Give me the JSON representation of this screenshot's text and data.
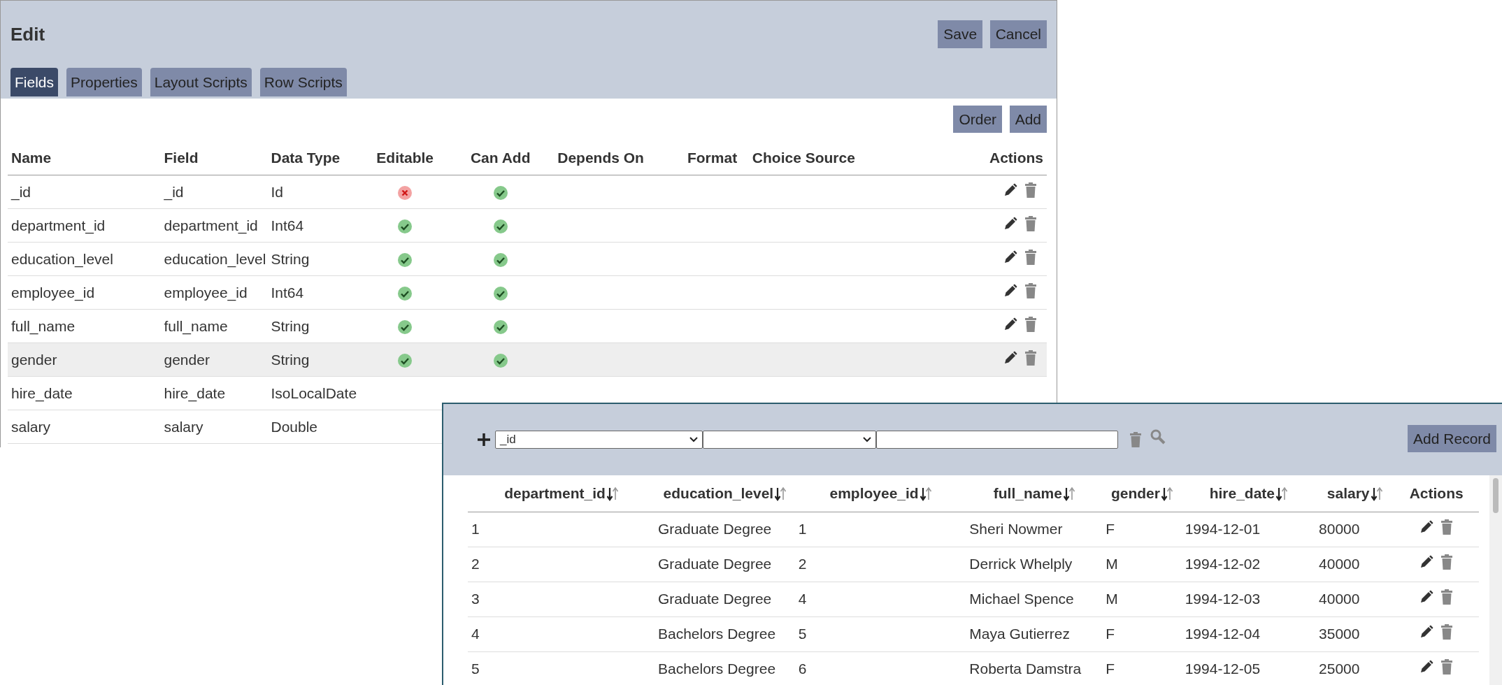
{
  "editor": {
    "title": "Edit",
    "buttons": [
      "Save",
      "Cancel"
    ],
    "tabs": [
      {
        "label": "Fields",
        "selected": true
      },
      {
        "label": "Properties",
        "selected": false
      },
      {
        "label": "Layout Scripts",
        "selected": false
      },
      {
        "label": "Row Scripts",
        "selected": false
      }
    ],
    "toolbar_buttons": [
      "Order",
      "Add"
    ],
    "table": {
      "columns": [
        "Name",
        "Field",
        "Data Type",
        "Editable",
        "Can Add",
        "Depends On",
        "Format",
        "Choice Source",
        "Actions"
      ],
      "rows": [
        {
          "name": "_id",
          "field": "_id",
          "data_type": "Id",
          "editable": false,
          "can_add": true,
          "selected": false
        },
        {
          "name": "department_id",
          "field": "department_id",
          "data_type": "Int64",
          "editable": true,
          "can_add": true,
          "selected": false
        },
        {
          "name": "education_level",
          "field": "education_level",
          "data_type": "String",
          "editable": true,
          "can_add": true,
          "selected": false
        },
        {
          "name": "employee_id",
          "field": "employee_id",
          "data_type": "Int64",
          "editable": true,
          "can_add": true,
          "selected": false
        },
        {
          "name": "full_name",
          "field": "full_name",
          "data_type": "String",
          "editable": true,
          "can_add": true,
          "selected": false
        },
        {
          "name": "gender",
          "field": "gender",
          "data_type": "String",
          "editable": true,
          "can_add": true,
          "selected": true
        },
        {
          "name": "hire_date",
          "field": "hire_date",
          "data_type": "IsoLocalDate",
          "selected": false
        },
        {
          "name": "salary",
          "field": "salary",
          "data_type": "Double",
          "selected": false
        }
      ]
    }
  },
  "records": {
    "filter": {
      "field_select": "_id"
    },
    "add_button": "Add Record",
    "table": {
      "columns": [
        "department_id",
        "education_level",
        "employee_id",
        "full_name",
        "gender",
        "hire_date",
        "salary",
        "Actions"
      ],
      "rows": [
        [
          "1",
          "Graduate Degree",
          "1",
          "Sheri Nowmer",
          "F",
          "1994-12-01",
          "80000"
        ],
        [
          "2",
          "Graduate Degree",
          "2",
          "Derrick Whelply",
          "M",
          "1994-12-02",
          "40000"
        ],
        [
          "3",
          "Graduate Degree",
          "4",
          "Michael Spence",
          "M",
          "1994-12-03",
          "40000"
        ],
        [
          "4",
          "Bachelors Degree",
          "5",
          "Maya Gutierrez",
          "F",
          "1994-12-04",
          "35000"
        ],
        [
          "5",
          "Bachelors Degree",
          "6",
          "Roberta Damstra",
          "F",
          "1994-12-05",
          "25000"
        ]
      ]
    }
  }
}
